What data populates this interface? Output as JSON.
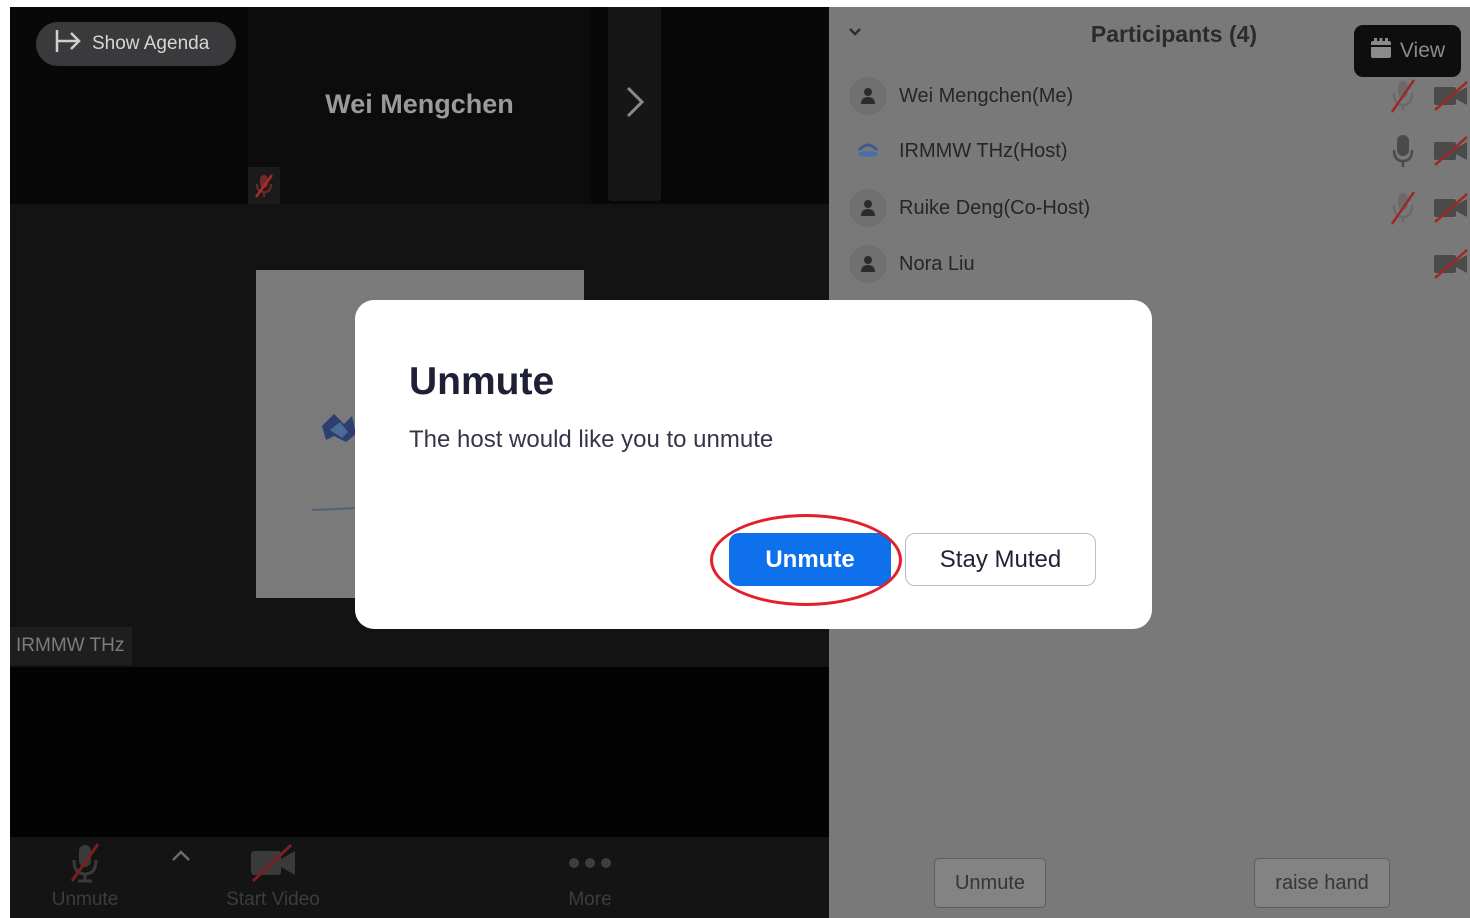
{
  "meeting": {
    "agenda_button_label": "Show Agenda",
    "tile_participant_name": "Wei Mengchen",
    "active_speaker_label": "IRMMW THz"
  },
  "toolbar": {
    "unmute_label": "Unmute",
    "start_video_label": "Start Video",
    "more_label": "More"
  },
  "participants_panel": {
    "title": "Participants (4)",
    "view_button_label": "View",
    "participants": [
      {
        "name": "Wei Mengchen(Me)",
        "mic": "muted",
        "video": "off"
      },
      {
        "name": "IRMMW THz(Host)",
        "mic": "on",
        "video": "off"
      },
      {
        "name": "Ruike Deng(Co-Host)",
        "mic": "muted",
        "video": "off"
      },
      {
        "name": "Nora Liu",
        "mic": "none",
        "video": "off"
      }
    ],
    "unmute_button_label": "Unmute",
    "raise_hand_button_label": "raise hand"
  },
  "dialog": {
    "title": "Unmute",
    "message": "The host would like you to unmute",
    "primary_button_label": "Unmute",
    "secondary_button_label": "Stay Muted"
  },
  "colors": {
    "primary_button": "#0e71eb",
    "highlight_ring": "#e2202b",
    "muted_slash": "#9e2828"
  }
}
